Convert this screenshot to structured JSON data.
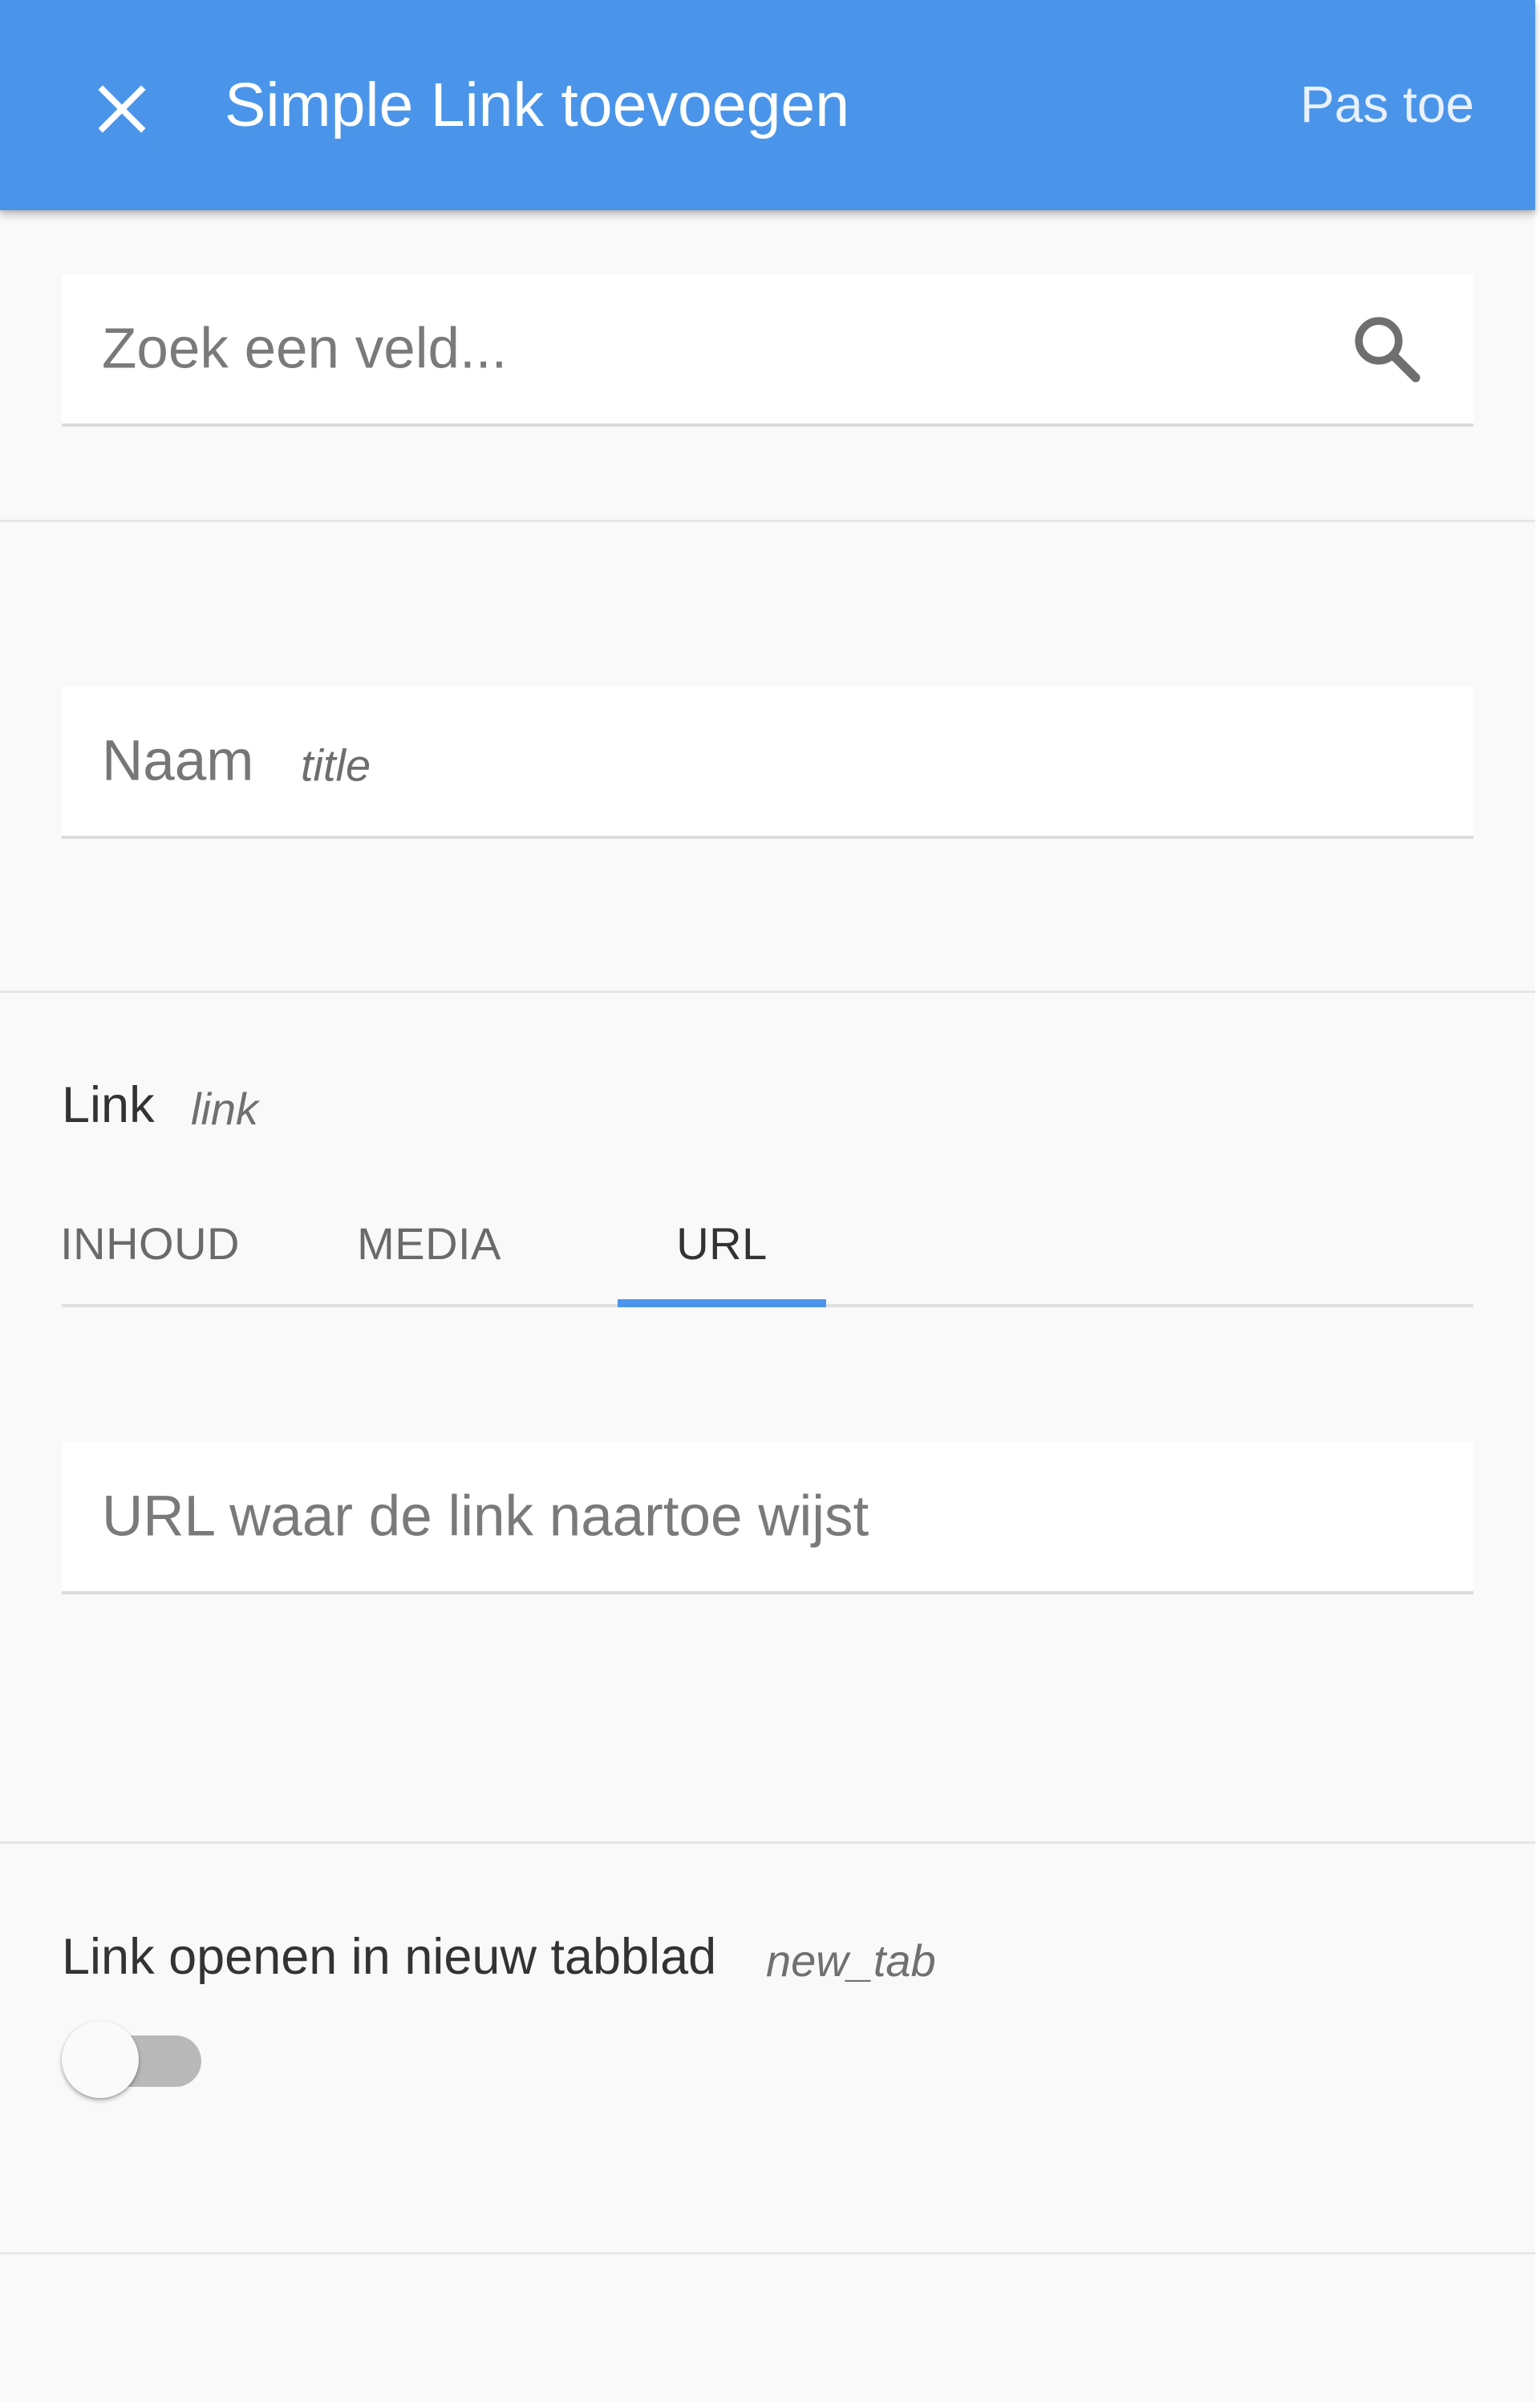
{
  "header": {
    "title": "Simple Link toevoegen",
    "apply_label": "Pas toe",
    "background_color": "#4a95ea"
  },
  "search": {
    "placeholder": "Zoek een veld...",
    "icon": "search-icon"
  },
  "fields": {
    "naam": {
      "label": "Naam",
      "key": "title"
    },
    "link": {
      "label": "Link",
      "key": "link",
      "tabs": [
        {
          "label": "INHOUD",
          "active": false
        },
        {
          "label": "MEDIA",
          "active": false
        },
        {
          "label": "URL",
          "active": true
        }
      ],
      "url_placeholder": "URL waar de link naartoe wijst"
    },
    "new_tab": {
      "label": "Link openen in nieuw tabblad",
      "key": "new_tab",
      "enabled": false
    }
  },
  "colors": {
    "accent": "#4a95ea",
    "background": "#f9f9f9"
  }
}
